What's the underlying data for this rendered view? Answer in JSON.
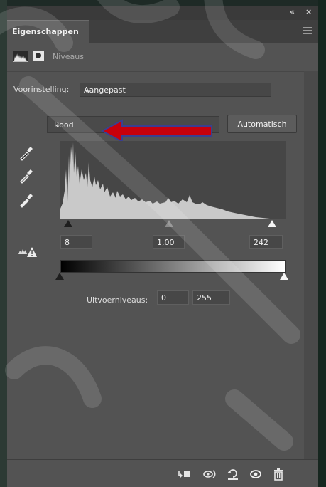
{
  "window": {
    "collapse_glyph": "«",
    "close_glyph": "×"
  },
  "panel": {
    "tab_label": "Eigenschappen",
    "menu_icon": "hamburger-menu-icon"
  },
  "adjustment": {
    "title": "Niveaus",
    "icons": [
      "levels-histogram-icon",
      "layer-mask-icon"
    ]
  },
  "preset": {
    "label": "Voorinstelling:",
    "value": "Aangepast"
  },
  "channel": {
    "value": "Rood",
    "auto_button": "Automatisch"
  },
  "annotation": {
    "arrow_color": "#c8000b",
    "arrow_outline": "#3b3f8f"
  },
  "eyedroppers": [
    "black-point-eyedropper-icon",
    "gray-point-eyedropper-icon",
    "white-point-eyedropper-icon"
  ],
  "input_levels": {
    "shadow": "8",
    "midtone": "1,00",
    "highlight": "242"
  },
  "output_levels": {
    "label": "Uitvoerniveaus:",
    "low": "0",
    "high": "255"
  },
  "footer_icons": [
    "clip-to-layer-icon",
    "view-previous-state-icon",
    "reset-icon",
    "visibility-eye-icon",
    "trash-icon"
  ],
  "colors": {
    "panel_bg": "#535353",
    "tab_bar": "#3f3f3f",
    "histogram_fill": "#c9c9c9",
    "histogram_bg": "#464646"
  }
}
